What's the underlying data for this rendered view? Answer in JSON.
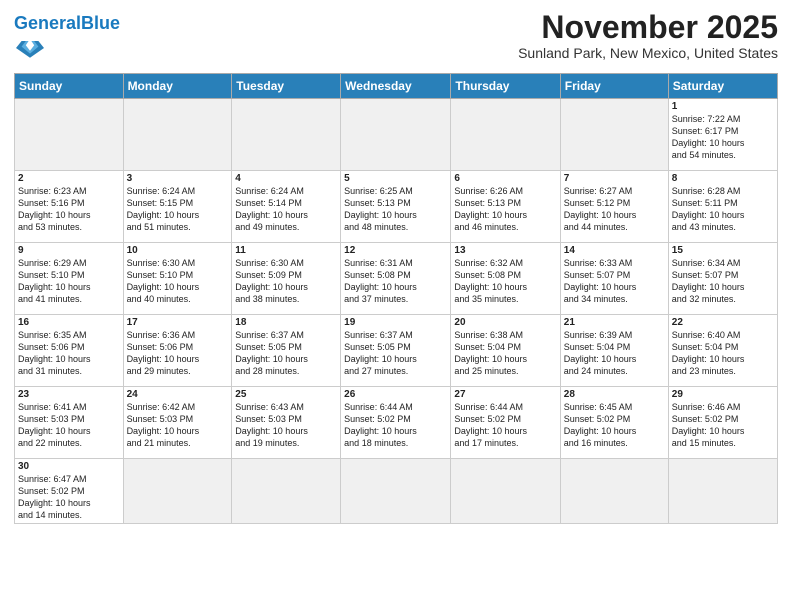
{
  "header": {
    "logo_general": "General",
    "logo_blue": "Blue",
    "month_title": "November 2025",
    "subtitle": "Sunland Park, New Mexico, United States"
  },
  "weekdays": [
    "Sunday",
    "Monday",
    "Tuesday",
    "Wednesday",
    "Thursday",
    "Friday",
    "Saturday"
  ],
  "weeks": [
    [
      {
        "day": "",
        "info": ""
      },
      {
        "day": "",
        "info": ""
      },
      {
        "day": "",
        "info": ""
      },
      {
        "day": "",
        "info": ""
      },
      {
        "day": "",
        "info": ""
      },
      {
        "day": "",
        "info": ""
      },
      {
        "day": "1",
        "info": "Sunrise: 7:22 AM\nSunset: 6:17 PM\nDaylight: 10 hours\nand 54 minutes."
      }
    ],
    [
      {
        "day": "2",
        "info": "Sunrise: 6:23 AM\nSunset: 5:16 PM\nDaylight: 10 hours\nand 53 minutes."
      },
      {
        "day": "3",
        "info": "Sunrise: 6:24 AM\nSunset: 5:15 PM\nDaylight: 10 hours\nand 51 minutes."
      },
      {
        "day": "4",
        "info": "Sunrise: 6:24 AM\nSunset: 5:14 PM\nDaylight: 10 hours\nand 49 minutes."
      },
      {
        "day": "5",
        "info": "Sunrise: 6:25 AM\nSunset: 5:13 PM\nDaylight: 10 hours\nand 48 minutes."
      },
      {
        "day": "6",
        "info": "Sunrise: 6:26 AM\nSunset: 5:13 PM\nDaylight: 10 hours\nand 46 minutes."
      },
      {
        "day": "7",
        "info": "Sunrise: 6:27 AM\nSunset: 5:12 PM\nDaylight: 10 hours\nand 44 minutes."
      },
      {
        "day": "8",
        "info": "Sunrise: 6:28 AM\nSunset: 5:11 PM\nDaylight: 10 hours\nand 43 minutes."
      }
    ],
    [
      {
        "day": "9",
        "info": "Sunrise: 6:29 AM\nSunset: 5:10 PM\nDaylight: 10 hours\nand 41 minutes."
      },
      {
        "day": "10",
        "info": "Sunrise: 6:30 AM\nSunset: 5:10 PM\nDaylight: 10 hours\nand 40 minutes."
      },
      {
        "day": "11",
        "info": "Sunrise: 6:30 AM\nSunset: 5:09 PM\nDaylight: 10 hours\nand 38 minutes."
      },
      {
        "day": "12",
        "info": "Sunrise: 6:31 AM\nSunset: 5:08 PM\nDaylight: 10 hours\nand 37 minutes."
      },
      {
        "day": "13",
        "info": "Sunrise: 6:32 AM\nSunset: 5:08 PM\nDaylight: 10 hours\nand 35 minutes."
      },
      {
        "day": "14",
        "info": "Sunrise: 6:33 AM\nSunset: 5:07 PM\nDaylight: 10 hours\nand 34 minutes."
      },
      {
        "day": "15",
        "info": "Sunrise: 6:34 AM\nSunset: 5:07 PM\nDaylight: 10 hours\nand 32 minutes."
      }
    ],
    [
      {
        "day": "16",
        "info": "Sunrise: 6:35 AM\nSunset: 5:06 PM\nDaylight: 10 hours\nand 31 minutes."
      },
      {
        "day": "17",
        "info": "Sunrise: 6:36 AM\nSunset: 5:06 PM\nDaylight: 10 hours\nand 29 minutes."
      },
      {
        "day": "18",
        "info": "Sunrise: 6:37 AM\nSunset: 5:05 PM\nDaylight: 10 hours\nand 28 minutes."
      },
      {
        "day": "19",
        "info": "Sunrise: 6:37 AM\nSunset: 5:05 PM\nDaylight: 10 hours\nand 27 minutes."
      },
      {
        "day": "20",
        "info": "Sunrise: 6:38 AM\nSunset: 5:04 PM\nDaylight: 10 hours\nand 25 minutes."
      },
      {
        "day": "21",
        "info": "Sunrise: 6:39 AM\nSunset: 5:04 PM\nDaylight: 10 hours\nand 24 minutes."
      },
      {
        "day": "22",
        "info": "Sunrise: 6:40 AM\nSunset: 5:04 PM\nDaylight: 10 hours\nand 23 minutes."
      }
    ],
    [
      {
        "day": "23",
        "info": "Sunrise: 6:41 AM\nSunset: 5:03 PM\nDaylight: 10 hours\nand 22 minutes."
      },
      {
        "day": "24",
        "info": "Sunrise: 6:42 AM\nSunset: 5:03 PM\nDaylight: 10 hours\nand 21 minutes."
      },
      {
        "day": "25",
        "info": "Sunrise: 6:43 AM\nSunset: 5:03 PM\nDaylight: 10 hours\nand 19 minutes."
      },
      {
        "day": "26",
        "info": "Sunrise: 6:44 AM\nSunset: 5:02 PM\nDaylight: 10 hours\nand 18 minutes."
      },
      {
        "day": "27",
        "info": "Sunrise: 6:44 AM\nSunset: 5:02 PM\nDaylight: 10 hours\nand 17 minutes."
      },
      {
        "day": "28",
        "info": "Sunrise: 6:45 AM\nSunset: 5:02 PM\nDaylight: 10 hours\nand 16 minutes."
      },
      {
        "day": "29",
        "info": "Sunrise: 6:46 AM\nSunset: 5:02 PM\nDaylight: 10 hours\nand 15 minutes."
      }
    ],
    [
      {
        "day": "30",
        "info": "Sunrise: 6:47 AM\nSunset: 5:02 PM\nDaylight: 10 hours\nand 14 minutes."
      },
      {
        "day": "",
        "info": ""
      },
      {
        "day": "",
        "info": ""
      },
      {
        "day": "",
        "info": ""
      },
      {
        "day": "",
        "info": ""
      },
      {
        "day": "",
        "info": ""
      },
      {
        "day": "",
        "info": ""
      }
    ]
  ]
}
